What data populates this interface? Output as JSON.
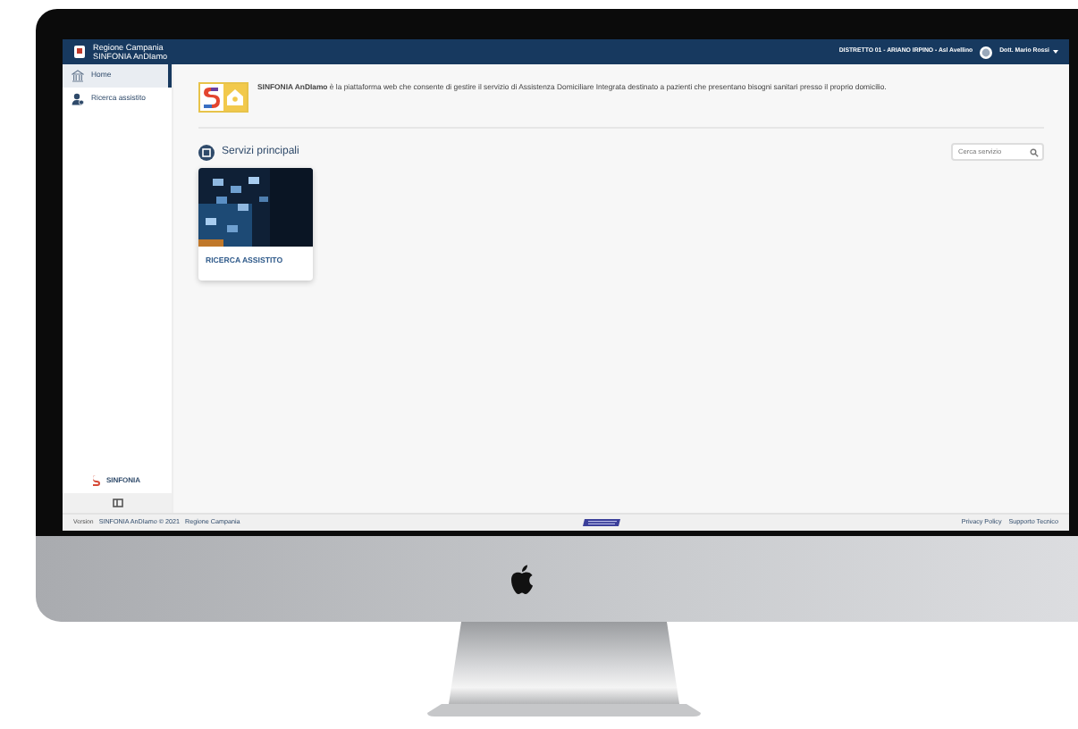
{
  "header": {
    "region": "Regione Campania",
    "app": "SINFONIA AnDIamo",
    "district": "DISTRETTO 01 - ARIANO IRPINO - Asl Avellino",
    "user": "Dott. Mario Rossi"
  },
  "sidebar": {
    "items": [
      {
        "label": "Home",
        "kind": "home",
        "selected": true
      },
      {
        "label": "Ricerca assistito",
        "kind": "user",
        "selected": false
      }
    ],
    "logo": "SINFONIA"
  },
  "intro": "**SINFONIA AnDIamo** è la piattaforma web che consente di gestire il servizio di Assistenza Domiciliare Integrata destinato a pazienti che presentano bisogni sanitari presso il proprio domicilio.",
  "section": {
    "title": "Servizi principali",
    "search": {
      "placeholder": "Cerca servizio"
    }
  },
  "services": [
    {
      "label": "RICERCA ASSISTITO"
    }
  ],
  "footer": {
    "version": "Version",
    "product": "SINFONIA AnDIamo © 2021",
    "org": "Regione Campania",
    "links": [
      "Privacy Policy",
      "Supporto Tecnico"
    ]
  }
}
